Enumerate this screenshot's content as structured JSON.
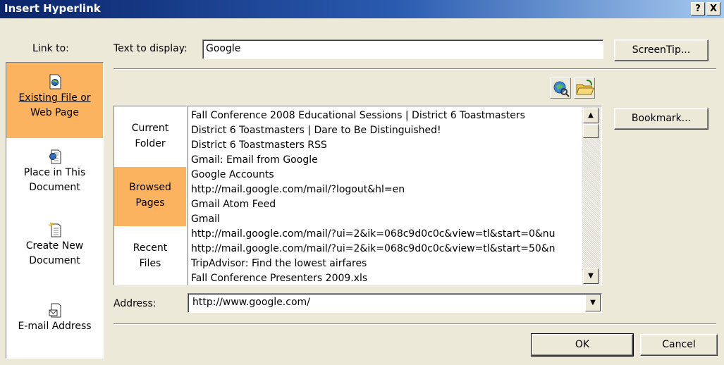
{
  "window": {
    "title": "Insert Hyperlink",
    "help_button": "?",
    "close_button": "X"
  },
  "link_to": {
    "label": "Link to:",
    "items": [
      {
        "line1": "Existing File or",
        "line2": "Web Page",
        "icon": "web-page-icon",
        "selected": true
      },
      {
        "line1": "Place in This",
        "line2": "Document",
        "icon": "document-place-icon",
        "selected": false
      },
      {
        "line1": "Create New",
        "line2": "Document",
        "icon": "new-document-icon",
        "selected": false
      },
      {
        "line1": "E-mail Address",
        "line2": "",
        "icon": "email-icon",
        "selected": false
      }
    ]
  },
  "text_to_display": {
    "label": "Text to display:",
    "value": "Google"
  },
  "buttons": {
    "screentip": "ScreenTip...",
    "bookmark": "Bookmark...",
    "ok": "OK",
    "cancel": "Cancel"
  },
  "toolbar_icons": [
    "browse-web-icon",
    "browse-file-icon"
  ],
  "look_in": {
    "items": [
      {
        "line1": "Current",
        "line2": "Folder",
        "selected": false
      },
      {
        "line1": "Browsed",
        "line2": "Pages",
        "selected": true
      },
      {
        "line1": "Recent",
        "line2": "Files",
        "selected": false
      }
    ]
  },
  "browsed_list": [
    "Fall Conference 2008 Educational Sessions | District 6 Toastmasters",
    "District 6 Toastmasters | Dare to Be Distinguished!",
    "District 6 Toastmasters RSS",
    "Gmail: Email from Google",
    "Google Accounts",
    "http://mail.google.com/mail/?logout&hl=en",
    "Gmail Atom Feed",
    "Gmail",
    "http://mail.google.com/mail/?ui=2&ik=068c9d0c0c&view=tl&start=0&nu",
    "http://mail.google.com/mail/?ui=2&ik=068c9d0c0c&view=tl&start=50&n",
    "TripAdvisor: Find the lowest airfares",
    "Fall Conference Presenters 2009.xls"
  ],
  "address": {
    "label": "Address:",
    "value": "http://www.google.com/"
  },
  "colors": {
    "selection": "#fbb360",
    "dialog_bg": "#ece9d8",
    "titlebar": "#0a246a"
  }
}
